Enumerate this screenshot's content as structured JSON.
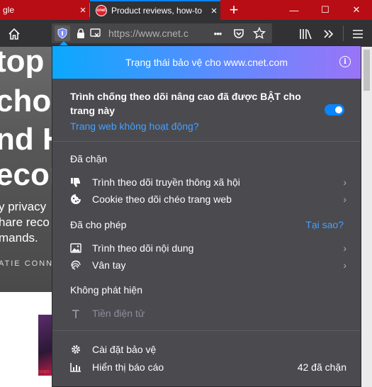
{
  "browser": {
    "tabs": [
      {
        "title": "gle",
        "close": "×"
      },
      {
        "title": "Product reviews, how-to",
        "favicon": "cnet",
        "close": "×"
      }
    ],
    "new_tab": "+",
    "url": "https://www.cnet.c",
    "page_actions": "•••",
    "window_controls": {
      "minimize": "—",
      "maximize": "☐",
      "close": "✕"
    }
  },
  "page": {
    "hero_lines": [
      "top s",
      "cho,",
      "nd H",
      "ecor"
    ],
    "hero_sub": [
      "y privacy",
      "hare reco",
      "mands."
    ],
    "hero_author": "ATIE CONN",
    "thumb_label": "cellph"
  },
  "panel": {
    "header_title": "Trạng thái bảo vệ cho www.cnet.com",
    "etp_status": "Trình chống theo dõi nâng cao đã được BẬT cho trang này",
    "etp_enabled": true,
    "site_broken_link": "Trang web không hoạt động?",
    "blocked_label": "Đã chặn",
    "blocked_items": [
      {
        "icon": "social-tracker-icon",
        "label": "Trình theo dõi truyền thông xã hội"
      },
      {
        "icon": "cookie-icon",
        "label": "Cookie theo dõi chéo trang web"
      }
    ],
    "allowed_label": "Đã cho phép",
    "why_link": "Tại sao?",
    "allowed_items": [
      {
        "icon": "image-icon",
        "label": "Trình theo dõi nội dung"
      },
      {
        "icon": "fingerprint-icon",
        "label": "Vân tay"
      }
    ],
    "not_detected_label": "Không phát hiện",
    "not_detected_items": [
      {
        "icon": "cryptominer-icon",
        "label": "Tiền điện tử"
      }
    ],
    "settings_label": "Cài đặt bảo vệ",
    "report_label": "Hiển thị báo cáo",
    "blocked_count": "42 đã chặn"
  },
  "colors": {
    "tabstrip": "#b80d14",
    "toolbar": "#323234",
    "panel_bg": "#4a4a4f",
    "accent": "#0a84ff",
    "link": "#45a1ff"
  }
}
